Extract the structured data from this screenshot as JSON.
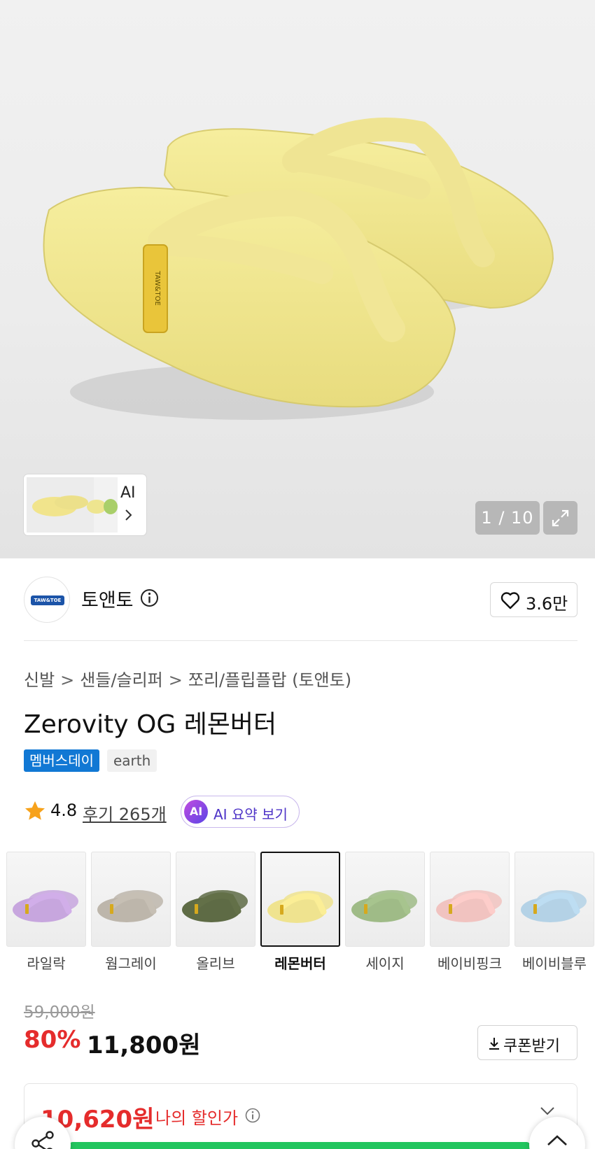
{
  "gallery": {
    "ai_thumb_label": "AI",
    "counter": "1 / 10"
  },
  "brand": {
    "name": "토앤토",
    "logo_text": "TAW&TOE",
    "likes": "3.6만"
  },
  "breadcrumb": [
    "신발",
    "샌들/슬리퍼",
    "쪼리/플립플랍 (토앤토)"
  ],
  "product": {
    "title": "Zerovity OG 레몬버터",
    "tags": [
      "멤버스데이",
      "earth"
    ]
  },
  "rating": {
    "score": "4.8",
    "reviews": "후기 265개",
    "ai_badge": "AI",
    "ai_summary": "AI 요약 보기"
  },
  "colors": [
    {
      "label": "라일락",
      "hex": "#c7a6de",
      "selected": false
    },
    {
      "label": "웜그레이",
      "hex": "#bdb6ab",
      "selected": false
    },
    {
      "label": "올리브",
      "hex": "#5e6b45",
      "selected": false
    },
    {
      "label": "레몬버터",
      "hex": "#efe38f",
      "selected": true
    },
    {
      "label": "세이지",
      "hex": "#9fbb87",
      "selected": false
    },
    {
      "label": "베이비핑크",
      "hex": "#f1c3c0",
      "selected": false
    },
    {
      "label": "베이비블루",
      "hex": "#b4d2e6",
      "selected": false
    }
  ],
  "price": {
    "original": "59,000원",
    "discount": "80%",
    "sale": "11,800원",
    "coupon": "쿠폰받기"
  },
  "my_price": {
    "amount": "10,620원",
    "label": "나의 할인가"
  },
  "theme": {
    "sale_red": "#e52c2c",
    "member_blue": "#1178d4",
    "progress_green": "#22c55e"
  }
}
